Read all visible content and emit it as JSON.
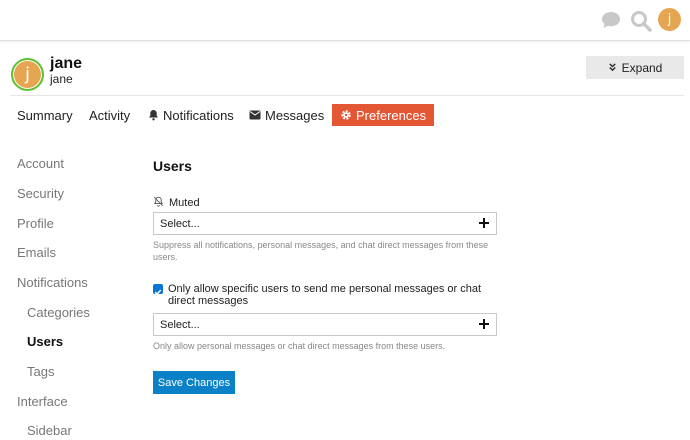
{
  "topbar": {
    "chat_icon": "chat-bubble-icon",
    "search_icon": "search-icon",
    "avatar_letter": "j"
  },
  "user": {
    "name": "jane",
    "username": "jane",
    "avatar_letter": "j",
    "avatar_color": "#e5a551",
    "status_ring_color": "#5ec236"
  },
  "header": {
    "expand_label": "Expand",
    "expand_icon": "chevrons-down-icon"
  },
  "tabs": [
    {
      "label": "Summary",
      "icon": ""
    },
    {
      "label": "Activity",
      "icon": ""
    },
    {
      "label": "Notifications",
      "icon": "bell-icon"
    },
    {
      "label": "Messages",
      "icon": "envelope-icon"
    },
    {
      "label": "Preferences",
      "icon": "gear-icon",
      "active": true
    }
  ],
  "sidebar": {
    "items": [
      {
        "label": "Account"
      },
      {
        "label": "Security"
      },
      {
        "label": "Profile"
      },
      {
        "label": "Emails"
      },
      {
        "label": "Notifications"
      },
      {
        "label": "Categories",
        "sub": true
      },
      {
        "label": "Users",
        "sub": true,
        "active": true
      },
      {
        "label": "Tags",
        "sub": true
      },
      {
        "label": "Interface"
      },
      {
        "label": "Sidebar",
        "sub": true
      }
    ]
  },
  "main": {
    "title": "Users",
    "muted": {
      "label": "Muted",
      "icon": "bell-slash-icon",
      "placeholder": "Select...",
      "help": "Suppress all notifications, personal messages, and chat direct messages from these users."
    },
    "allow": {
      "checked": true,
      "label": "Only allow specific users to send me personal messages or chat direct messages",
      "placeholder": "Select...",
      "help": "Only allow personal messages or chat direct messages from these users."
    },
    "save_label": "Save Changes"
  },
  "colors": {
    "accent": "#e45735",
    "primary_button": "#0a80c6",
    "checkbox": "#0a75d6"
  }
}
